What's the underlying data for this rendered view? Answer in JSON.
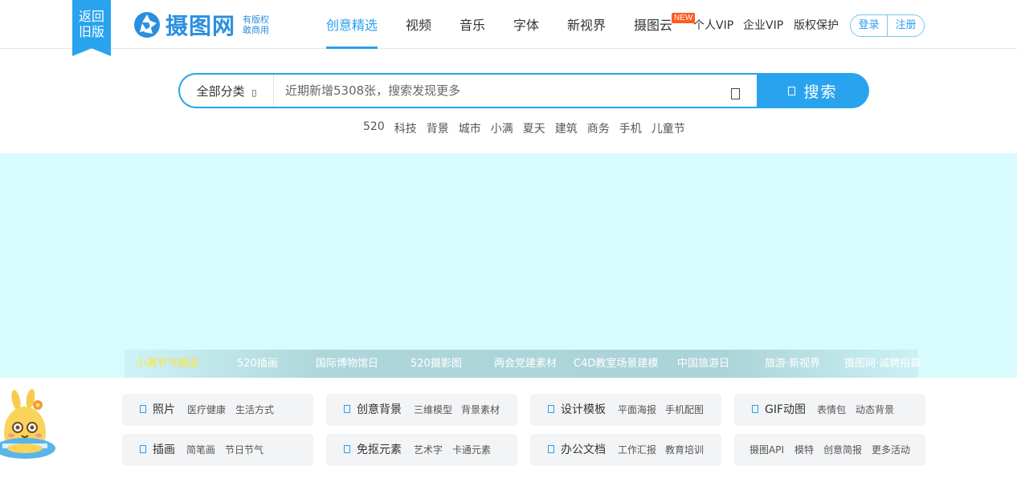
{
  "header": {
    "old_version": [
      "返回",
      "旧版"
    ],
    "logo": {
      "name": "摄图网",
      "sub": [
        "有版权",
        "敢商用"
      ]
    },
    "nav": [
      {
        "label": "创意精选",
        "active": true
      },
      {
        "label": "视频"
      },
      {
        "label": "音乐"
      },
      {
        "label": "字体"
      },
      {
        "label": "新视界"
      },
      {
        "label": "摄图云"
      }
    ],
    "new_badge": "NEW",
    "links": [
      "个人VIP",
      "企业VIP",
      "版权保护"
    ],
    "login": "登录",
    "register": "注册"
  },
  "search": {
    "category": "全部分类",
    "category_arrow": "▯",
    "placeholder": "近期新增5308张，搜索发现更多",
    "camera_icon": "camera-icon",
    "button": "搜索",
    "hot": [
      "520",
      "科技",
      "背景",
      "城市",
      "小满",
      "夏天",
      "建筑",
      "商务",
      "手机",
      "儿童节"
    ]
  },
  "banner": {
    "background": "#d8fbfd",
    "tabs": [
      "小满节气精选",
      "520插画",
      "国际博物馆日",
      "520摄影图",
      "两会党建素材",
      "C4D教室场景建模",
      "中国旅游日",
      "旅游·新视界",
      "摄图网·诚聘招募"
    ],
    "active_tab": 0
  },
  "quick_links": [
    {
      "title": "照片",
      "subs": [
        "医疗健康",
        "生活方式"
      ]
    },
    {
      "title": "创意背景",
      "subs": [
        "三维模型",
        "背景素材"
      ]
    },
    {
      "title": "设计模板",
      "subs": [
        "平面海报",
        "手机配图"
      ]
    },
    {
      "title": "GIF动图",
      "subs": [
        "表情包",
        "动态背景"
      ]
    },
    {
      "title": "插画",
      "subs": [
        "简笔画",
        "节日节气"
      ]
    },
    {
      "title": "免抠元素",
      "subs": [
        "艺术字",
        "卡通元素"
      ]
    },
    {
      "title": "办公文档",
      "subs": [
        "工作汇报",
        "教育培训"
      ]
    },
    {
      "title": "",
      "subs": [
        "摄图API",
        "模特",
        "创意简报",
        "更多活动"
      ]
    }
  ],
  "colors": {
    "accent": "#2aa3ef",
    "badge": "#ff5a1f",
    "active_tab_text": "#ffe23a"
  }
}
